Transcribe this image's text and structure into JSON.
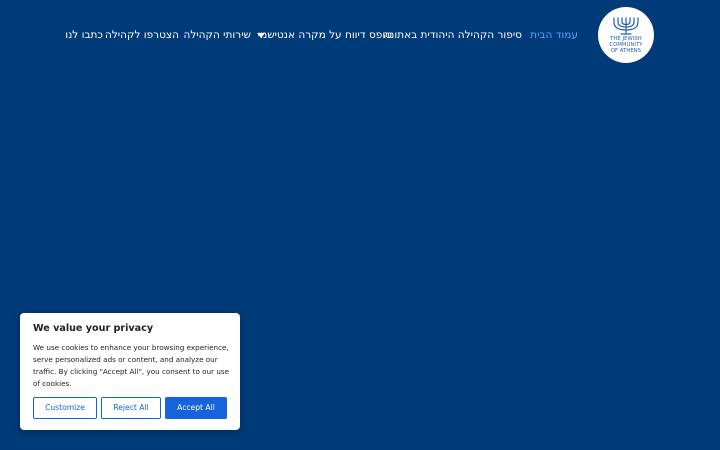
{
  "logo": {
    "icon": "menorah-icon",
    "lines": [
      "THE JEWISH",
      "COMMUNITY",
      "OF ATHENS"
    ]
  },
  "nav": {
    "items": [
      {
        "label": "עמוד הבית",
        "active": true
      },
      {
        "label": "סיפור הקהילה היהודית באתונה"
      },
      {
        "label": "טופס דיווח על מקרה אנטישמי"
      },
      {
        "label": "שירותי הקהילה",
        "has_dropdown": true,
        "dropdown_icon": "caret-down-icon"
      },
      {
        "label": "הצטרפו לקהילה"
      },
      {
        "label": "כתבו לנו"
      }
    ]
  },
  "cookie_banner": {
    "title": "We value your privacy",
    "body": "We use cookies to enhance your browsing experience, serve personalized ads or content, and analyze our traffic. By clicking \"Accept All\", you consent to our use of cookies.",
    "customize_label": "Customize",
    "reject_label": "Reject All",
    "accept_label": "Accept All"
  },
  "colors": {
    "background": "#003a78",
    "accent": "#1863dc",
    "active_link": "#4aa8ff"
  }
}
